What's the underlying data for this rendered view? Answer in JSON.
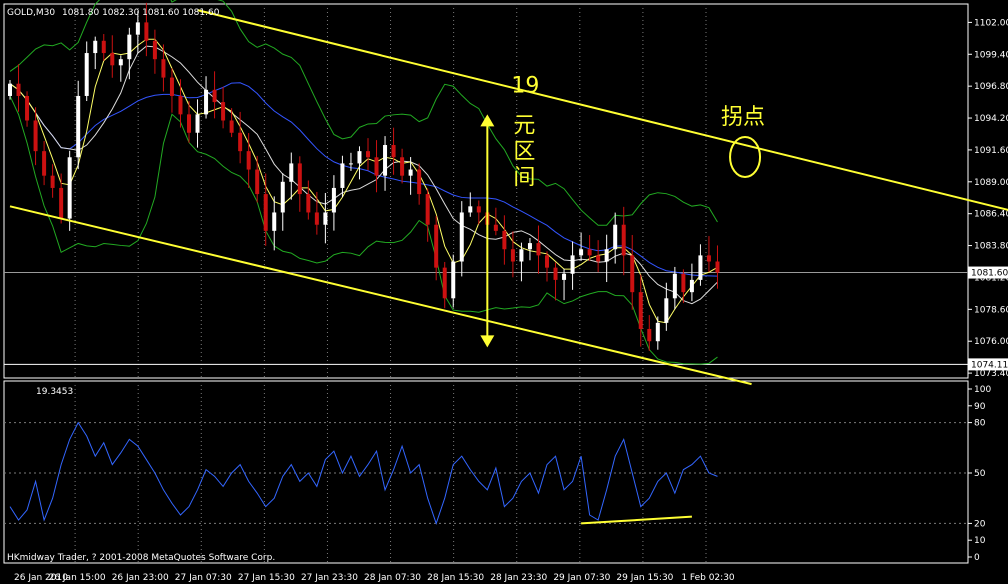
{
  "header": {
    "symbol": "GOLD,M30",
    "ohlc": "1081.80 1082.30 1081.60 1081.60"
  },
  "indicator": {
    "readout": "19.3453"
  },
  "copyright": "HKmidway Trader, ? 2001-2008 MetaQuotes Software Corp.",
  "annotations": {
    "range_number": "19",
    "range_chars": [
      "元",
      "区",
      "间"
    ],
    "turn_point": "拐点"
  },
  "colors": {
    "background": "#000000",
    "candle_up": "#ffffff",
    "candle_down": "#cc1111",
    "channel": "#ffff33",
    "bollinger": "#22aa22",
    "ma_fast": "#ffff66",
    "ma_mid": "#dddddd",
    "ma_slow": "#3355ff",
    "oscillator": "#3366ff",
    "grid": "#7a7a7a"
  },
  "chart_data": [
    {
      "type": "candlestick",
      "ylim": [
        1073.0,
        1103.5
      ],
      "price_ticks": [
        "1102.00",
        "1099.40",
        "1096.80",
        "1094.20",
        "1091.60",
        "1089.00",
        "1086.40",
        "1083.80",
        "1081.20",
        "1078.60",
        "1076.00",
        "1073.40"
      ],
      "price_tick_values": [
        1102.0,
        1099.4,
        1096.8,
        1094.2,
        1091.6,
        1089.0,
        1086.4,
        1083.8,
        1081.2,
        1078.6,
        1076.0,
        1073.4
      ],
      "current_price": {
        "label": "1081.60",
        "value": 1081.6
      },
      "low_marker": {
        "label": "1074.11",
        "value": 1074.11
      },
      "time_labels": [
        "26 Jan 2010",
        "26 Jan 15:00",
        "26 Jan 23:00",
        "27 Jan 07:30",
        "27 Jan 15:30",
        "27 Jan 23:30",
        "28 Jan 07:30",
        "28 Jan 15:30",
        "28 Jan 23:30",
        "29 Jan 07:30",
        "29 Jan 15:30",
        "1 Feb 02:30"
      ],
      "close_series": [
        1097.0,
        1096.0,
        1094.0,
        1091.5,
        1089.5,
        1088.5,
        1086.0,
        1091.0,
        1096.0,
        1099.5,
        1100.5,
        1099.5,
        1098.5,
        1099.0,
        1101.0,
        1102.0,
        1100.5,
        1099.0,
        1097.5,
        1096.0,
        1094.5,
        1093.0,
        1094.5,
        1096.5,
        1095.5,
        1094.0,
        1093.0,
        1091.5,
        1090.0,
        1088.0,
        1085.0,
        1086.5,
        1089.0,
        1090.5,
        1088.0,
        1086.5,
        1085.5,
        1086.5,
        1088.5,
        1090.5,
        1090.5,
        1091.5,
        1091.0,
        1089.5,
        1092.0,
        1091.0,
        1089.5,
        1090.0,
        1088.0,
        1085.5,
        1082.0,
        1079.5,
        1082.5,
        1086.5,
        1087.0,
        1086.5,
        1085.5,
        1085.0,
        1083.5,
        1082.5,
        1083.5,
        1084.0,
        1083.0,
        1082.0,
        1081.0,
        1081.5,
        1083.0,
        1083.5,
        1083.0,
        1082.5,
        1083.5,
        1085.5,
        1083.0,
        1080.0,
        1077.0,
        1076.0,
        1077.5,
        1079.5,
        1081.5,
        1080.0,
        1081.0,
        1083.0,
        1082.5,
        1081.6
      ],
      "open_first": 1096.0,
      "channel_lines": [
        {
          "name": "upper",
          "from": {
            "bar": 22,
            "price": 1103.0
          },
          "to": {
            "bar": 130,
            "price": 1084.5
          }
        },
        {
          "name": "lower",
          "from": {
            "bar": 0,
            "price": 1087.0
          },
          "to": {
            "bar": 87,
            "price": 1072.5
          }
        }
      ],
      "range_arrow": {
        "bar": 56,
        "top": 1094.5,
        "bottom": 1075.5
      },
      "pivot_bar": 86
    },
    {
      "type": "line",
      "ylim": [
        0,
        100
      ],
      "ticks": [
        "100",
        "90",
        "80",
        "50",
        "20",
        "10",
        "0"
      ],
      "tick_values": [
        100,
        90,
        80,
        50,
        20,
        10,
        0
      ],
      "levels": [
        80,
        50,
        20
      ],
      "values": [
        30,
        22,
        28,
        45,
        22,
        35,
        55,
        70,
        80,
        72,
        60,
        68,
        55,
        62,
        70,
        66,
        58,
        50,
        40,
        32,
        25,
        30,
        40,
        52,
        48,
        42,
        50,
        55,
        45,
        38,
        30,
        35,
        48,
        55,
        45,
        50,
        42,
        58,
        63,
        50,
        60,
        48,
        55,
        63,
        40,
        52,
        66,
        50,
        55,
        35,
        20,
        35,
        55,
        60,
        52,
        45,
        40,
        53,
        30,
        35,
        45,
        50,
        38,
        55,
        60,
        40,
        45,
        60,
        25,
        22,
        40,
        60,
        70,
        50,
        30,
        35,
        45,
        50,
        38,
        52,
        55,
        60,
        50,
        48
      ],
      "support_line": {
        "from_bar": 67,
        "to_bar": 80,
        "from_value": 20,
        "to_value": 24
      }
    }
  ]
}
